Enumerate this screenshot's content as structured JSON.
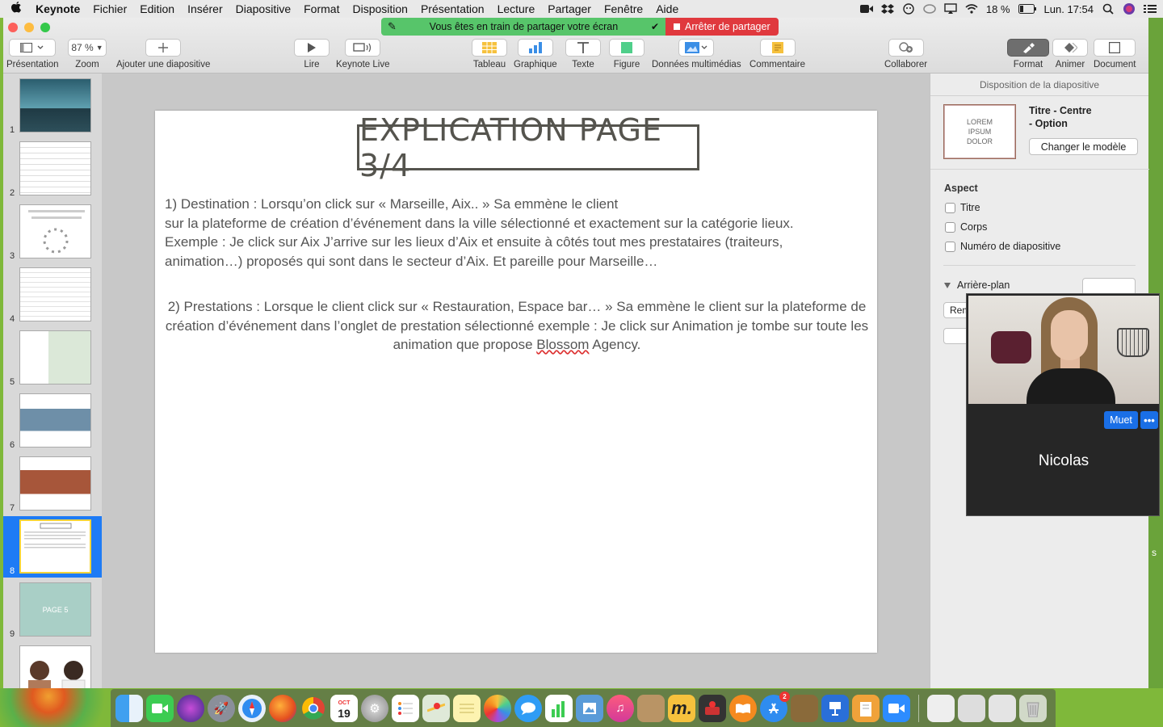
{
  "menubar": {
    "apple": "",
    "app": "Keynote",
    "items": [
      "Fichier",
      "Edition",
      "Insérer",
      "Diapositive",
      "Format",
      "Disposition",
      "Présentation",
      "Lecture",
      "Partager",
      "Fenêtre",
      "Aide"
    ],
    "battery": "18 %",
    "clock": "Lun. 17:54"
  },
  "share_banner": {
    "status": "Vous êtes en train de partager votre écran",
    "stop": "Arrêter de partager"
  },
  "toolbar": {
    "presentation_label": "Présentation",
    "zoom_value": "87 %",
    "zoom_label": "Zoom",
    "add_slide_label": "Ajouter une diapositive",
    "play_label": "Lire",
    "keynote_live_label": "Keynote Live",
    "table_label": "Tableau",
    "chart_label": "Graphique",
    "text_label": "Texte",
    "shape_label": "Figure",
    "media_label": "Données multimédias",
    "comment_label": "Commentaire",
    "collaborate_label": "Collaborer",
    "format_label": "Format",
    "animate_label": "Animer",
    "document_label": "Document"
  },
  "navigator": {
    "slides": [
      {
        "num": "1"
      },
      {
        "num": "2"
      },
      {
        "num": "3"
      },
      {
        "num": "4"
      },
      {
        "num": "5"
      },
      {
        "num": "6"
      },
      {
        "num": "7"
      },
      {
        "num": "8",
        "selected": true
      },
      {
        "num": "9",
        "caption": "PAGE 5"
      }
    ]
  },
  "slide": {
    "title": "EXPLICATION PAGE 3/4",
    "para1_line1": "1)   Destination : Lorsqu’on click sur « Marseille, Aix.. » Sa emmène le client",
    "para1_line2": "sur la plateforme de création d’événement dans la ville sélectionné et exactement sur la catégorie lieux.",
    "para1_line3": "Exemple : Je click sur Aix J’arrive sur les lieux d’Aix et ensuite à côtés tout mes prestataires (traiteurs,",
    "para1_line4": "animation…) proposés qui sont dans le secteur d’Aix. Et pareille pour Marseille…",
    "para2_a": "2) Prestations : Lorsque le client click sur « Restauration, Espace bar… » Sa emmène le client sur la plateforme de création d’événement dans l’onglet de prestation sélectionné exemple : Je click sur Animation je tombe sur toute les animation que propose ",
    "para2_misspelled": "Blossom",
    "para2_b": " Agency."
  },
  "inspector": {
    "header": "Disposition de la diapositive",
    "layout_preview": "LOREM IPSUM DOLOR",
    "layout_name_1": "Titre - Centre",
    "layout_name_2": "- Option",
    "change_template": "Changer le modèle",
    "aspect_title": "Aspect",
    "checkbox_title": "Titre",
    "checkbox_body": "Corps",
    "checkbox_slide_number": "Numéro de diapositive",
    "background_title": "Arrière-plan",
    "partial_button": "Rem"
  },
  "video_call": {
    "mute_label": "Muet",
    "more_label": "•••",
    "participant_name": "Nicolas"
  },
  "dock": {
    "calendar_month": "OCT",
    "calendar_day": "19",
    "appstore_badge": "2"
  },
  "colors": {
    "accent_selected": "#1e7bf5",
    "share_green": "#57c56a",
    "share_red": "#e0393e",
    "title_border": "#55544e",
    "zoom_blue": "#1a6fe6"
  }
}
